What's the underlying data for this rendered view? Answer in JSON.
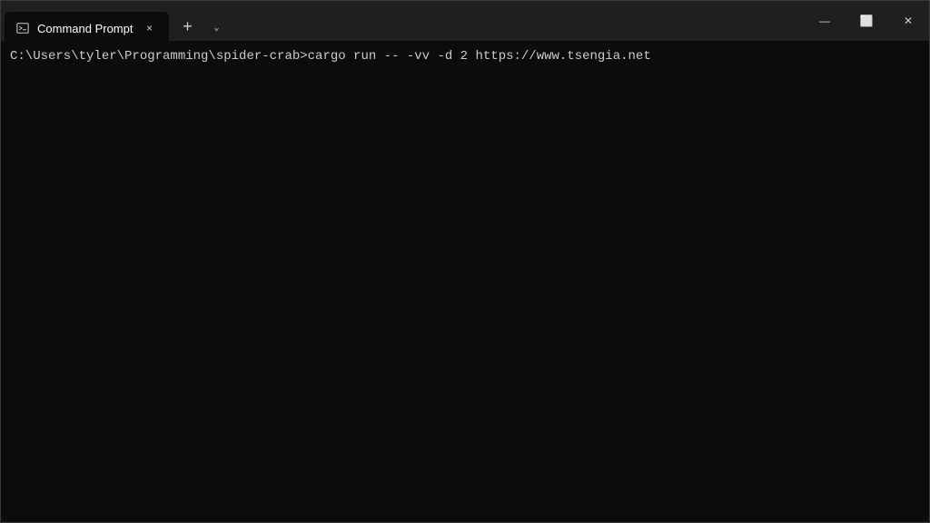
{
  "titlebar": {
    "tab_label": "Command Prompt",
    "tab_close_label": "×",
    "new_tab_label": "+",
    "dropdown_label": "⌄"
  },
  "window_controls": {
    "minimize": "—",
    "maximize": "⬜",
    "close": "✕"
  },
  "terminal": {
    "line": "C:\\Users\\tyler\\Programming\\spider-crab>cargo run -- -vv -d 2 https://www.tsengia.net"
  }
}
